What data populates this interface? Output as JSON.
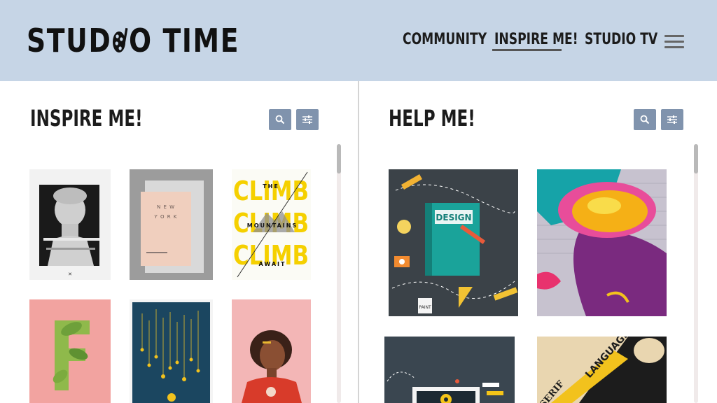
{
  "header": {
    "logo_text_left": "STUD",
    "logo_text_right": "O TIME",
    "nav": {
      "community": "COMMUNITY",
      "inspire": "INSPIRE ME!",
      "studio_tv": "STUDIO TV"
    },
    "active_nav": "INSPIRE ME!",
    "menu_icon": "hamburger-icon"
  },
  "left_panel": {
    "title": "INSPIRE ME!",
    "search_icon": "search-icon",
    "filter_icon": "sliders-icon",
    "posters": {
      "ny": {
        "line1": "N E W",
        "line2": "Y O R K"
      },
      "climb": {
        "big": "CLIMB",
        "line1": "THE",
        "line2": "MOUNTAINS",
        "line3": "AWAIT"
      },
      "letter": "F"
    }
  },
  "right_panel": {
    "title": "HELP ME!",
    "search_icon": "search-icon",
    "filter_icon": "sliders-icon",
    "cards": {
      "design": {
        "label": "DESIGN",
        "paint": "PAINT"
      },
      "typography": {
        "word1": "LANGUAGE",
        "word2": "SERIF"
      }
    }
  },
  "colors": {
    "header_bg": "#c6d5e6",
    "button_bg": "#8093ad",
    "climb_yellow": "#f5d000"
  }
}
